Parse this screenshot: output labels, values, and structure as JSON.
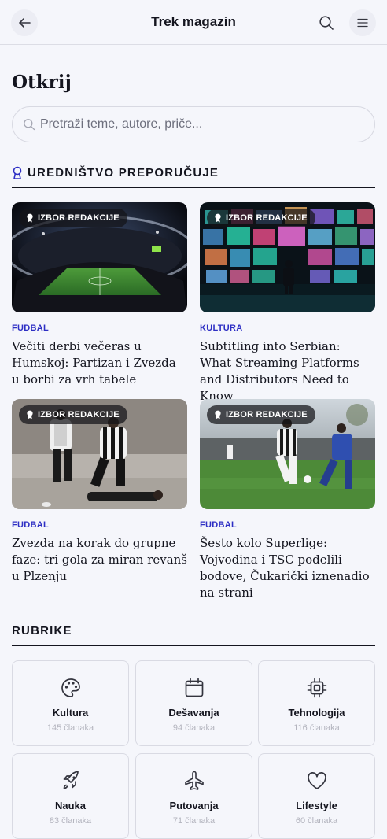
{
  "header": {
    "title": "Trek magazin",
    "back_icon": "arrow-left-icon",
    "search_icon": "search-icon",
    "menu_icon": "hamburger-menu-icon"
  },
  "page": {
    "title": "Otkrij"
  },
  "search": {
    "placeholder": "Pretraži teme, autore, priče...",
    "value": ""
  },
  "editors": {
    "heading": "UREDNIŠTVO PREPORUČUJE",
    "icon": "award-ribbon-icon",
    "badge_label": "IZBOR REDAKCIJE",
    "badge_icon": "award-icon",
    "articles": [
      {
        "category": "FUDBAL",
        "title": "Večiti derbi večeras u Humskoj: Partizan i Zvezda u borbi za vrh tabele",
        "image": "stadium-at-night"
      },
      {
        "category": "KULTURA",
        "title": "Subtitling into Serbian: What Streaming Platforms and Distributors Need to Know",
        "image": "wall-of-screens"
      },
      {
        "category": "FUDBAL",
        "title": "Zvezda na korak do grupne faze: tri gola za miran revanš u Plzenju",
        "image": "football-tackle"
      },
      {
        "category": "FUDBAL",
        "title": "Šesto kolo Superlige: Vojvodina i TSC podelili bodove, Čukarički iznenadio na strani",
        "image": "football-match-action"
      }
    ]
  },
  "rubrike": {
    "heading": "RUBRIKE",
    "items": [
      {
        "name": "Kultura",
        "count": "145 članaka",
        "icon": "palette-icon"
      },
      {
        "name": "Dešavanja",
        "count": "94 članaka",
        "icon": "calendar-icon"
      },
      {
        "name": "Tehnologija",
        "count": "116 članaka",
        "icon": "chip-icon"
      },
      {
        "name": "Nauka",
        "count": "83 članaka",
        "icon": "rocket-icon"
      },
      {
        "name": "Putovanja",
        "count": "71 članaka",
        "icon": "airplane-icon"
      },
      {
        "name": "Lifestyle",
        "count": "60 članaka",
        "icon": "heart-icon"
      }
    ]
  },
  "colors": {
    "background": "#f5f6fb",
    "accent": "#2e2fc4",
    "text": "#14151f"
  }
}
